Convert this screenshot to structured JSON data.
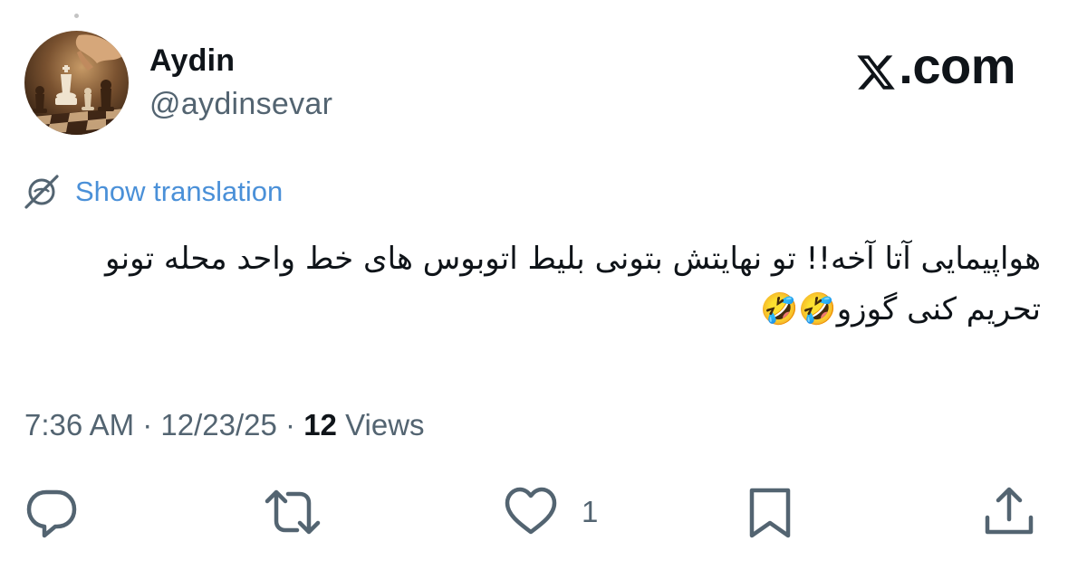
{
  "author": {
    "display_name": "Aydin",
    "handle": "@aydinsevar",
    "avatar_icon": "chess-pieces-avatar"
  },
  "brand": {
    "logo_text": ".com",
    "logo_icon": "x-logo-icon"
  },
  "translation": {
    "label": "Show translation",
    "icon": "globe-slash-icon",
    "color": "#4a90d8"
  },
  "tweet": {
    "text": "هواپیمایی آتا آخه!!  تو نهایتش بتونی بلیط اتوبوس های خط واحد محله تونو تحریم کنی گوزو🤣🤣"
  },
  "meta": {
    "time": "7:36 AM",
    "separator_1": " · ",
    "date": "12/23/25",
    "separator_2": " · ",
    "views_count": "12",
    "views_label": " Views"
  },
  "actions": {
    "reply_icon": "reply-icon",
    "retweet_icon": "retweet-icon",
    "like_icon": "heart-icon",
    "like_count": "1",
    "bookmark_icon": "bookmark-icon",
    "share_icon": "share-icon"
  },
  "colors": {
    "text_primary": "#0f1419",
    "text_secondary": "#536471",
    "icon_gray": "#536471"
  }
}
